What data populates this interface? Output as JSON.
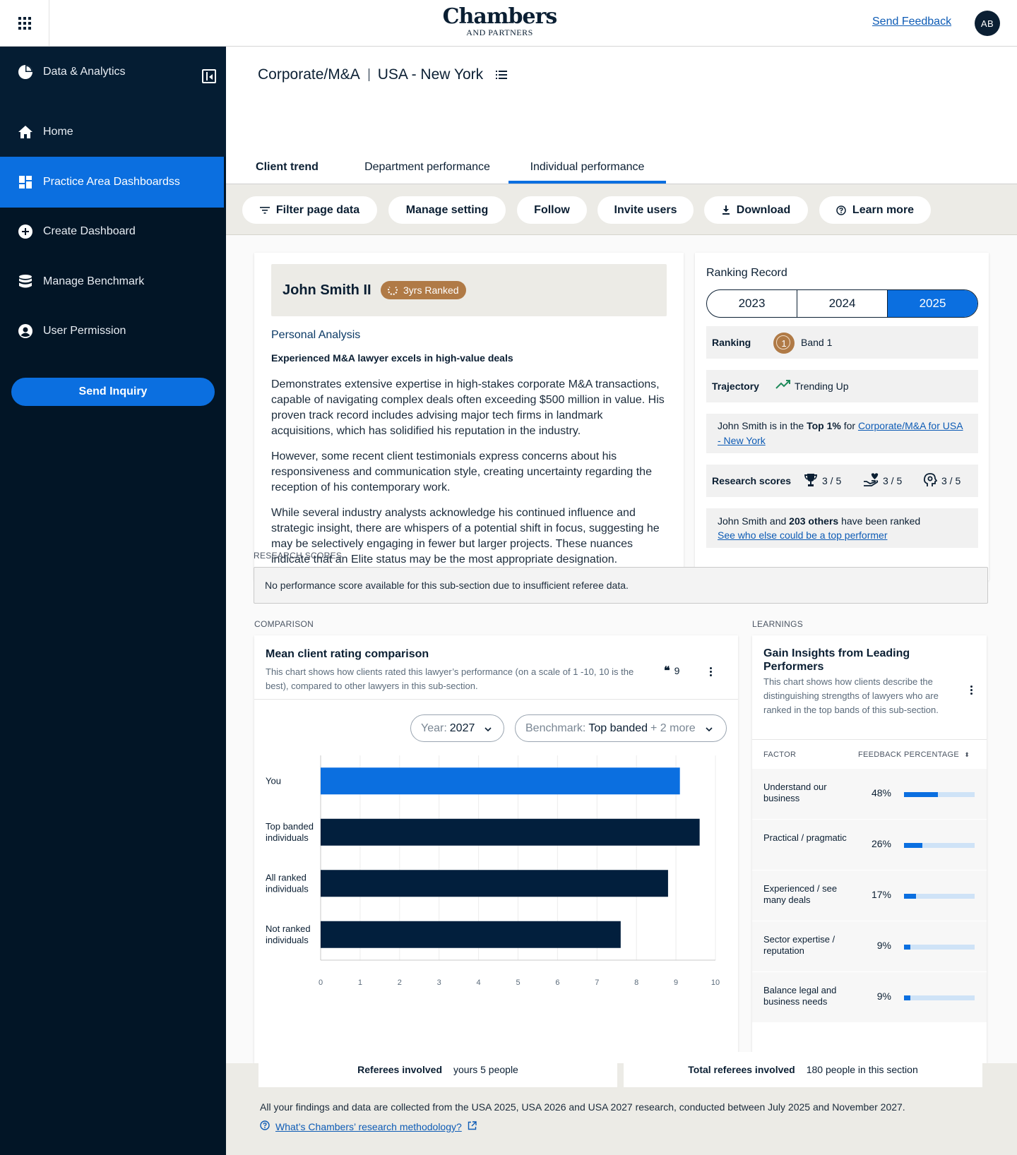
{
  "topbar": {
    "logo_line1": "Chambers",
    "logo_line2": "AND PARTNERS",
    "feedback_label": "Send  Feedback",
    "avatar_initials": "AB"
  },
  "sidebar": {
    "header_label": "Data & Analytics",
    "items": [
      {
        "label": "Home",
        "icon": "home-icon"
      },
      {
        "label": "Practice Area Dashboardss",
        "icon": "dashboard-icon",
        "active": true
      },
      {
        "label": "Create Dashboard",
        "icon": "plus-circle-icon"
      },
      {
        "label": "Manage Benchmark",
        "icon": "database-icon"
      },
      {
        "label": "User Permission",
        "icon": "user-circle-icon"
      }
    ],
    "inquiry_label": "Send Inquiry"
  },
  "breadcrumb": {
    "practice": "Corporate/M&A",
    "location": "USA - New York"
  },
  "tabs": [
    {
      "label": "Client trend"
    },
    {
      "label": "Department performance"
    },
    {
      "label": "Individual performance",
      "selected": true
    }
  ],
  "toolbar": {
    "filter": "Filter page data",
    "manage": "Manage setting",
    "follow": "Follow",
    "invite": "Invite users",
    "download": "Download",
    "learn": "Learn more"
  },
  "profile": {
    "name": "John Smith II",
    "ranked_badge": "3yrs Ranked",
    "section_title": "Personal Analysis",
    "headline": "Experienced M&A lawyer excels in high-value deals",
    "paragraphs": [
      "Demonstrates extensive expertise in high-stakes corporate M&A transactions, capable of navigating complex deals often exceeding $500 million in value. His proven track record includes advising major tech firms in landmark acquisitions, which has solidified his reputation in the industry.",
      "However, some recent client testimonials express concerns about his responsiveness and communication style, creating uncertainty regarding the reception of his contemporary work.",
      "While several industry analysts acknowledge his continued influence and strategic insight, there are whispers of a potential shift in focus, suggesting he may be selectively engaging in fewer but larger projects. These nuances indicate that an Elite status may be the most appropriate designation."
    ]
  },
  "ranking_record": {
    "title": "Ranking Record",
    "years": [
      "2023",
      "2024",
      "2025"
    ],
    "selected_year": "2025",
    "ranking_label": "Ranking",
    "medal_number": "1",
    "band": "Band 1",
    "trajectory_label": "Trajectory",
    "trajectory_value": "Trending Up",
    "top_text_pre": "John Smith is in the ",
    "top_text_bold": "Top 1%",
    "top_text_mid": " for ",
    "top_text_link": "Corporate/M&A for  USA - New York",
    "scores_label": "Research scores",
    "scores": [
      {
        "icon": "trophy-icon",
        "value": "3 / 5"
      },
      {
        "icon": "hand-heart-icon",
        "value": "3 / 5"
      },
      {
        "icon": "head-gear-icon",
        "value": "3 / 5"
      }
    ],
    "others_pre": "John Smith and ",
    "others_bold": "203 others",
    "others_post": " have been ranked",
    "others_link": "See who else could be a top performer"
  },
  "research_scores": {
    "label": "RESEARCH SCORES",
    "message": "No performance score available for this sub-section due to insufficient referee data."
  },
  "comparison": {
    "label": "COMPARISON",
    "title": "Mean client rating comparison",
    "description": "This chart shows how clients rated this lawyer’s performance (on a scale of 1 -10, 10 is the best), compared to other lawyers in this sub-section.",
    "quote_count": "9",
    "year_key": "Year:",
    "year_value": "2027",
    "bench_key": "Benchmark:",
    "bench_value": "Top banded",
    "bench_more": "+ 2 more"
  },
  "chart_data": {
    "type": "bar",
    "orientation": "horizontal",
    "categories": [
      "You",
      "Top banded individuals",
      "All ranked individuals",
      "Not ranked individuals"
    ],
    "category_lines": [
      [
        "You"
      ],
      [
        "Top banded",
        "individuals"
      ],
      [
        "All ranked",
        "individuals"
      ],
      [
        "Not ranked",
        "individuals"
      ]
    ],
    "values": [
      9.1,
      9.6,
      8.8,
      7.6
    ],
    "colors": [
      "#0b6fe0",
      "#021f3d",
      "#021f3d",
      "#021f3d"
    ],
    "xlim": [
      0,
      10
    ],
    "ticks": [
      "0",
      "1",
      "2",
      "3",
      "4",
      "5",
      "6",
      "7",
      "8",
      "9",
      "10"
    ],
    "grid": true
  },
  "learnings": {
    "label": "LEARNINGS",
    "title": "Gain Insights from Leading Performers",
    "description": "This chart shows how clients describe the distinguishing strengths of lawyers who are ranked in the top bands of this sub-section.",
    "col_factor": "FACTOR",
    "col_pct": "FEEDBACK PERCENTAGE",
    "rows": [
      {
        "factor": "Understand our business",
        "pct": "48%",
        "fill": 0.48
      },
      {
        "factor": "Practical / pragmatic",
        "pct": "26%",
        "fill": 0.26
      },
      {
        "factor": "Experienced / see many deals",
        "pct": "17%",
        "fill": 0.17
      },
      {
        "factor": "Sector expertise / reputation",
        "pct": "9%",
        "fill": 0.09
      },
      {
        "factor": "Balance legal and business needs",
        "pct": "9%",
        "fill": 0.09
      }
    ]
  },
  "footer": {
    "referees_label": "Referees involved",
    "referees_value": "yours 5 people",
    "total_label": "Total referees involved",
    "total_value": "180 people in this section",
    "note": "All your findings and data are collected from the USA 2025, USA 2026 and USA 2027 research, conducted between July 2025 and November 2027.",
    "methodology_link": "What’s Chambers’ research methodology?"
  }
}
